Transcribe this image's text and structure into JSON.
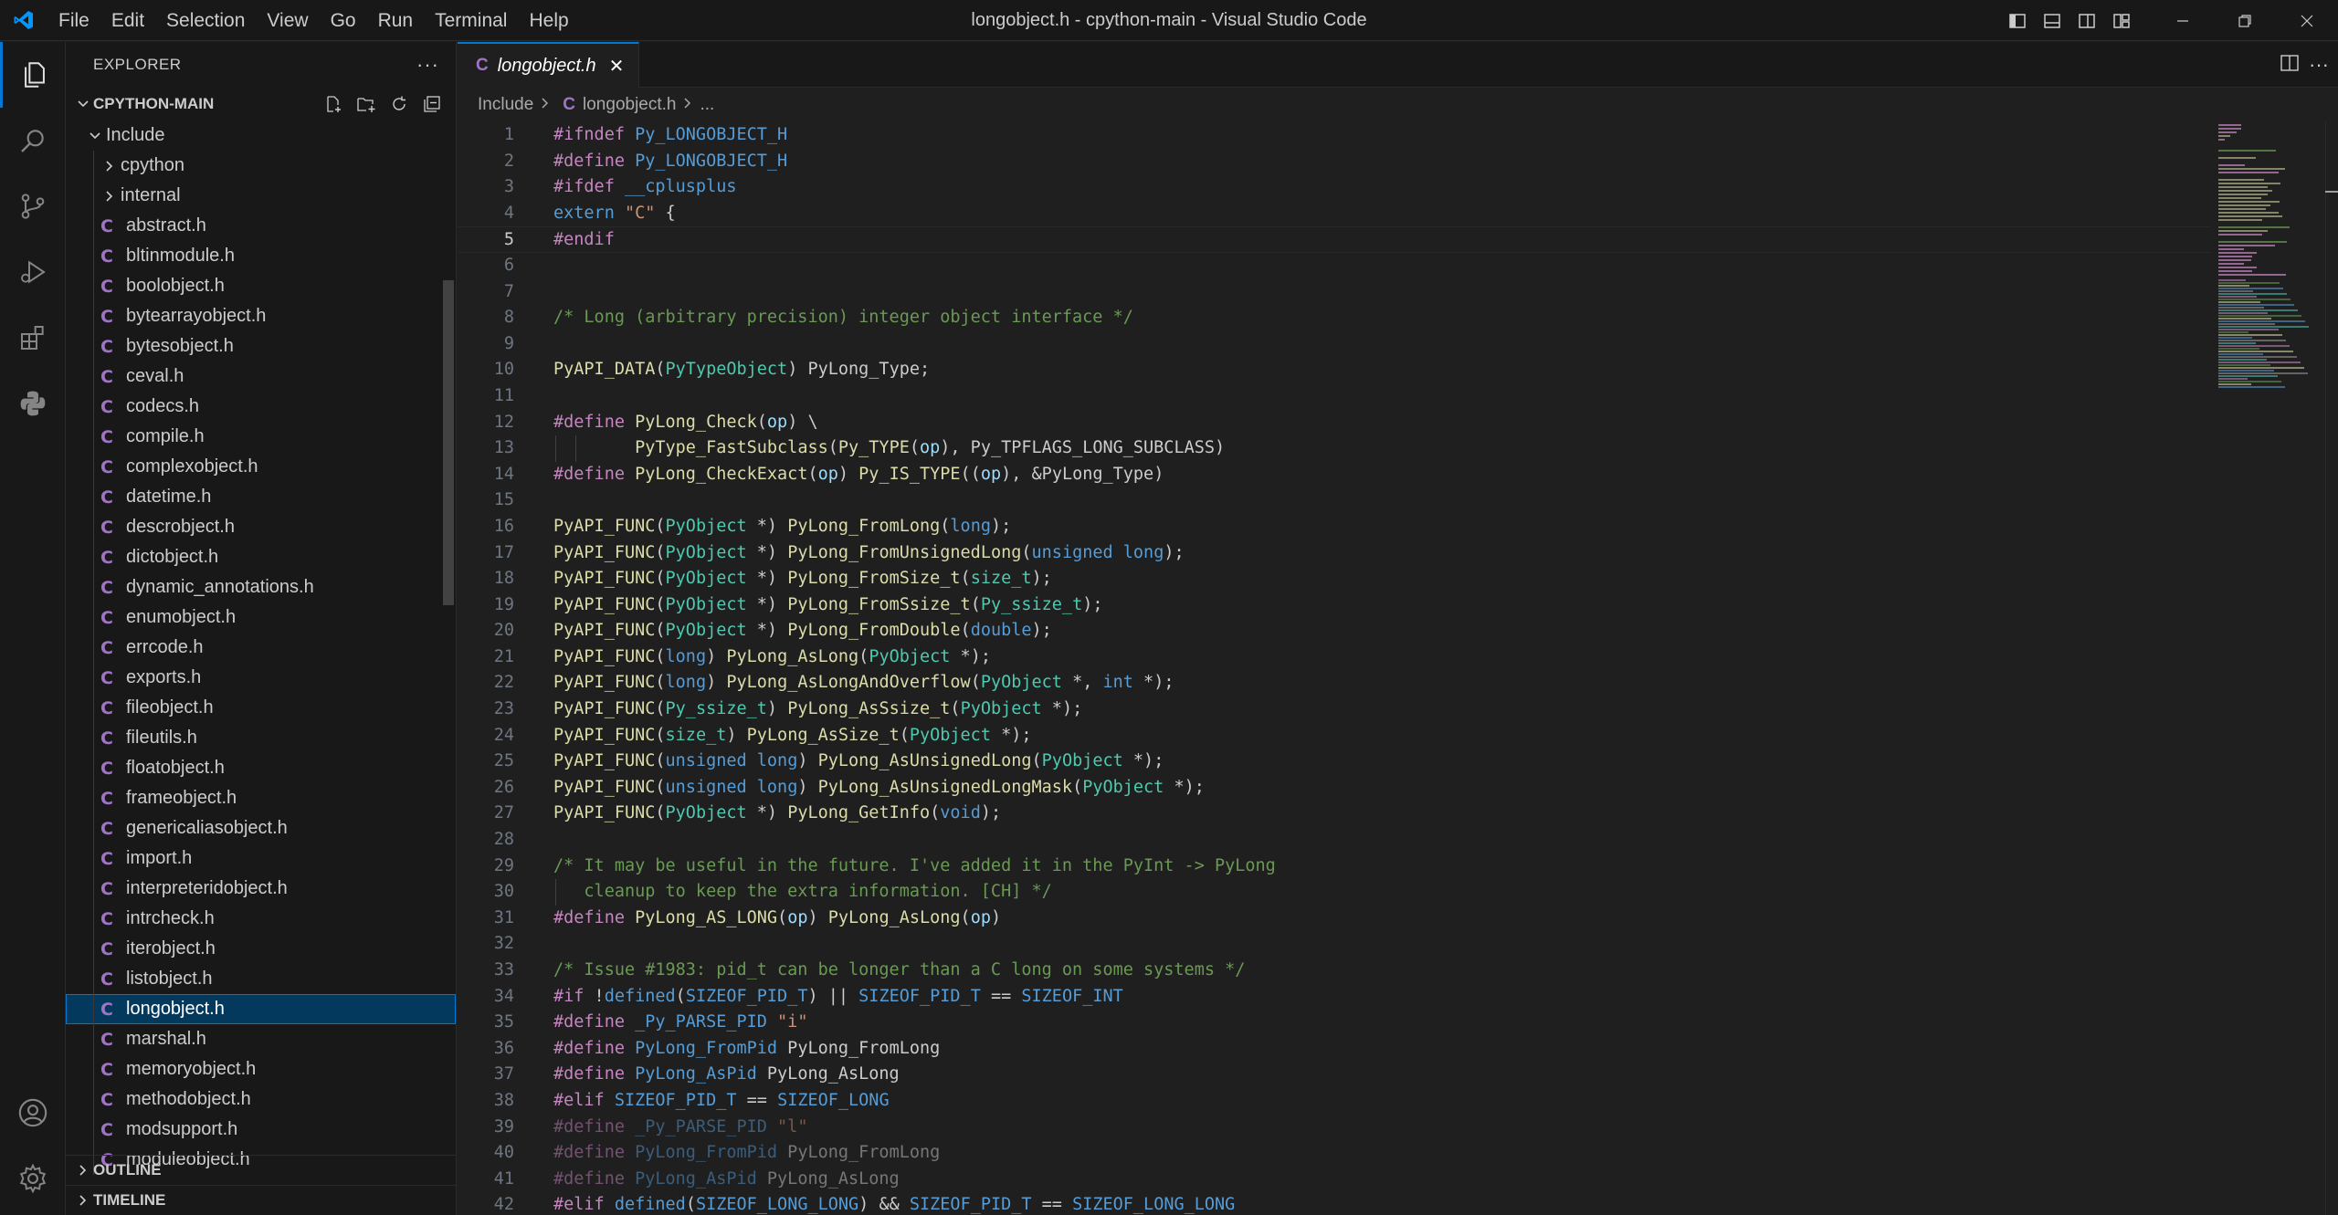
{
  "window": {
    "title": "longobject.h - cpython-main - Visual Studio Code",
    "menu": [
      "File",
      "Edit",
      "Selection",
      "View",
      "Go",
      "Run",
      "Terminal",
      "Help"
    ]
  },
  "activity_bar": [
    "explorer-icon",
    "search-icon",
    "source-control-icon",
    "run-debug-icon",
    "extensions-icon",
    "python-icon",
    "accounts-icon",
    "manage-gear-icon"
  ],
  "sidebar": {
    "header": "EXPLORER",
    "more": "···",
    "workspace": "CPYTHON-MAIN",
    "root_folder": "Include",
    "subfolders": [
      "cpython",
      "internal"
    ],
    "files": [
      "abstract.h",
      "bltinmodule.h",
      "boolobject.h",
      "bytearrayobject.h",
      "bytesobject.h",
      "ceval.h",
      "codecs.h",
      "compile.h",
      "complexobject.h",
      "datetime.h",
      "descrobject.h",
      "dictobject.h",
      "dynamic_annotations.h",
      "enumobject.h",
      "errcode.h",
      "exports.h",
      "fileobject.h",
      "fileutils.h",
      "floatobject.h",
      "frameobject.h",
      "genericaliasobject.h",
      "import.h",
      "interpreteridobject.h",
      "intrcheck.h",
      "iterobject.h",
      "listobject.h",
      "longobject.h",
      "marshal.h",
      "memoryobject.h",
      "methodobject.h",
      "modsupport.h",
      "moduleobject.h"
    ],
    "selected_file": "longobject.h",
    "c_glyph": "C",
    "outline": "OUTLINE",
    "timeline": "TIMELINE"
  },
  "editor": {
    "tab": "longobject.h",
    "close": "✕",
    "breadcrumb": [
      "Include",
      "longobject.h",
      "..."
    ],
    "current_line": 5,
    "lines": [
      {
        "n": "1",
        "t": "#ifndef Py_LONGOBJECT_H"
      },
      {
        "n": "2",
        "t": "#define Py_LONGOBJECT_H"
      },
      {
        "n": "3",
        "t": "#ifdef __cplusplus"
      },
      {
        "n": "4",
        "t": "extern \"C\" {"
      },
      {
        "n": "5",
        "t": "#endif"
      },
      {
        "n": "6",
        "t": ""
      },
      {
        "n": "7",
        "t": ""
      },
      {
        "n": "8",
        "t": "/* Long (arbitrary precision) integer object interface */"
      },
      {
        "n": "9",
        "t": ""
      },
      {
        "n": "10",
        "t": "PyAPI_DATA(PyTypeObject) PyLong_Type;"
      },
      {
        "n": "11",
        "t": ""
      },
      {
        "n": "12",
        "t": "#define PyLong_Check(op) \\"
      },
      {
        "n": "13",
        "t": "        PyType_FastSubclass(Py_TYPE(op), Py_TPFLAGS_LONG_SUBCLASS)"
      },
      {
        "n": "14",
        "t": "#define PyLong_CheckExact(op) Py_IS_TYPE((op), &PyLong_Type)"
      },
      {
        "n": "15",
        "t": ""
      },
      {
        "n": "16",
        "t": "PyAPI_FUNC(PyObject *) PyLong_FromLong(long);"
      },
      {
        "n": "17",
        "t": "PyAPI_FUNC(PyObject *) PyLong_FromUnsignedLong(unsigned long);"
      },
      {
        "n": "18",
        "t": "PyAPI_FUNC(PyObject *) PyLong_FromSize_t(size_t);"
      },
      {
        "n": "19",
        "t": "PyAPI_FUNC(PyObject *) PyLong_FromSsize_t(Py_ssize_t);"
      },
      {
        "n": "20",
        "t": "PyAPI_FUNC(PyObject *) PyLong_FromDouble(double);"
      },
      {
        "n": "21",
        "t": "PyAPI_FUNC(long) PyLong_AsLong(PyObject *);"
      },
      {
        "n": "22",
        "t": "PyAPI_FUNC(long) PyLong_AsLongAndOverflow(PyObject *, int *);"
      },
      {
        "n": "23",
        "t": "PyAPI_FUNC(Py_ssize_t) PyLong_AsSsize_t(PyObject *);"
      },
      {
        "n": "24",
        "t": "PyAPI_FUNC(size_t) PyLong_AsSize_t(PyObject *);"
      },
      {
        "n": "25",
        "t": "PyAPI_FUNC(unsigned long) PyLong_AsUnsignedLong(PyObject *);"
      },
      {
        "n": "26",
        "t": "PyAPI_FUNC(unsigned long) PyLong_AsUnsignedLongMask(PyObject *);"
      },
      {
        "n": "27",
        "t": "PyAPI_FUNC(PyObject *) PyLong_GetInfo(void);"
      },
      {
        "n": "28",
        "t": ""
      },
      {
        "n": "29",
        "t": "/* It may be useful in the future. I've added it in the PyInt -> PyLong"
      },
      {
        "n": "30",
        "t": "   cleanup to keep the extra information. [CH] */"
      },
      {
        "n": "31",
        "t": "#define PyLong_AS_LONG(op) PyLong_AsLong(op)"
      },
      {
        "n": "32",
        "t": ""
      },
      {
        "n": "33",
        "t": "/* Issue #1983: pid_t can be longer than a C long on some systems */"
      },
      {
        "n": "34",
        "t": "#if !defined(SIZEOF_PID_T) || SIZEOF_PID_T == SIZEOF_INT"
      },
      {
        "n": "35",
        "t": "#define _Py_PARSE_PID \"i\""
      },
      {
        "n": "36",
        "t": "#define PyLong_FromPid PyLong_FromLong"
      },
      {
        "n": "37",
        "t": "#define PyLong_AsPid PyLong_AsLong"
      },
      {
        "n": "38",
        "t": "#elif SIZEOF_PID_T == SIZEOF_LONG"
      },
      {
        "n": "39",
        "t": "#define _Py_PARSE_PID \"l\""
      },
      {
        "n": "40",
        "t": "#define PyLong_FromPid PyLong_FromLong"
      },
      {
        "n": "41",
        "t": "#define PyLong_AsPid PyLong_AsLong"
      },
      {
        "n": "42",
        "t": "#elif defined(SIZEOF_LONG_LONG) && SIZEOF_PID_T == SIZEOF_LONG_LONG"
      }
    ],
    "inactive_lines": [
      39,
      40,
      41
    ]
  },
  "colors": {
    "accent": "#0078d4",
    "c_file_icon": "#a074c4",
    "preprocessor": "#c586c0",
    "keyword": "#569cd6",
    "function": "#dcdcaa",
    "type": "#4ec9b0",
    "string": "#ce9178",
    "comment": "#6a9955"
  }
}
